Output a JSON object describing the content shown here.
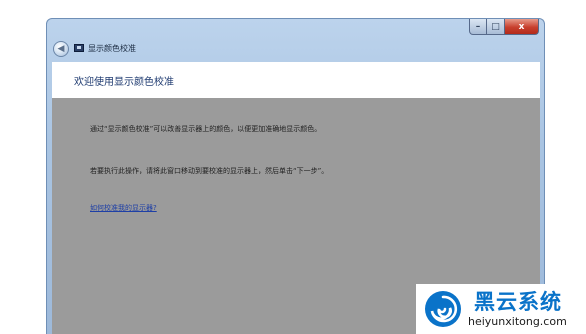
{
  "window": {
    "title": "显示颜色校准",
    "caption_buttons": {
      "minimize": "–",
      "maximize": "□",
      "close": "x"
    }
  },
  "header": {
    "title": "欢迎使用显示颜色校准"
  },
  "content": {
    "paragraph1": "通过“显示颜色校准”可以改善显示器上的颜色，以便更加准确地显示颜色。",
    "paragraph2": "若要执行此操作，请将此窗口移动到要校准的显示器上，然后单击“下一步”。",
    "help_link": "如何校准我的显示器?"
  },
  "watermark": {
    "brand_name": "黑云系统",
    "url": "heiyunxitong.com"
  },
  "colors": {
    "content_bg": "#9b9b9b",
    "header_title": "#1e3a70",
    "link": "#1e3fa6",
    "brand_blue": "#0a73c9"
  }
}
